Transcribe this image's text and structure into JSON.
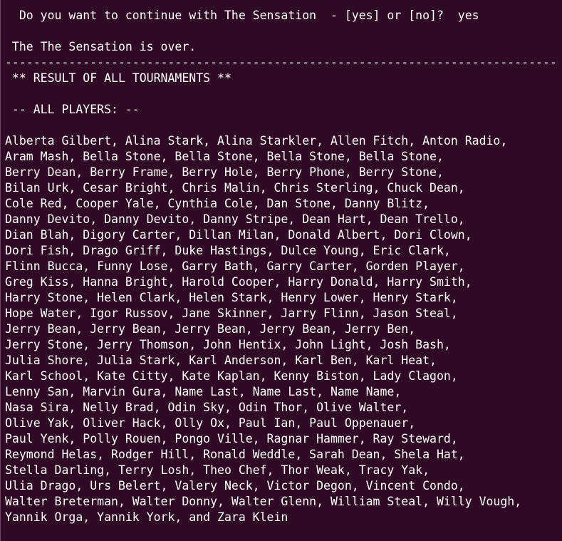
{
  "terminal": {
    "header_lines": [
      "  Do you want to continue with The Sensation  - [yes] or [no]?  yes",
      "",
      " The The Sensation is over.",
      "------------------------------------------------------------------------------",
      " ** RESULT OF ALL TOURNAMENTS **",
      "",
      " -- ALL PLAYERS: --",
      ""
    ],
    "player_lines": [
      "Alberta Gilbert, Alina Stark, Alina Starkler, Allen Fitch, Anton Radio,",
      "Aram Mash, Bella Stone, Bella Stone, Bella Stone, Bella Stone,",
      "Berry Dean, Berry Frame, Berry Hole, Berry Phone, Berry Stone,",
      "Bilan Urk, Cesar Bright, Chris Malin, Chris Sterling, Chuck Dean,",
      "Cole Red, Cooper Yale, Cynthia Cole, Dan Stone, Danny Blitz,",
      "Danny Devito, Danny Devito, Danny Stripe, Dean Hart, Dean Trello,",
      "Dian Blah, Digory Carter, Dillan Milan, Donald Albert, Dori Clown,",
      "Dori Fish, Drago Griff, Duke Hastings, Dulce Young, Eric Clark,",
      "Flinn Bucca, Funny Lose, Garry Bath, Garry Carter, Gorden Player,",
      "Greg Kiss, Hanna Bright, Harold Cooper, Harry Donald, Harry Smith,",
      "Harry Stone, Helen Clark, Helen Stark, Henry Lower, Henry Stark,",
      "Hope Water, Igor Russov, Jane Skinner, Jarry Flinn, Jason Steal,",
      "Jerry Bean, Jerry Bean, Jerry Bean, Jerry Bean, Jerry Ben,",
      "Jerry Stone, Jerry Thomson, John Hentix, John Light, Josh Bash,",
      "Julia Shore, Julia Stark, Karl Anderson, Karl Ben, Karl Heat,",
      "Karl School, Kate Citty, Kate Kaplan, Kenny Biston, Lady Clagon,",
      "Lenny San, Marvin Gura, Name Last, Name Last, Name Name,",
      "Nasa Sira, Nelly Brad, Odin Sky, Odin Thor, Olive Walter,",
      "Olive Yak, Oliver Hack, Olly Ox, Paul Ian, Paul Oppenauer,",
      "Paul Yenk, Polly Rouen, Pongo Ville, Ragnar Hammer, Ray Steward,",
      "Reymond Helas, Rodger Hill, Ronald Weddle, Sarah Dean, Shela Hat,",
      "Stella Darling, Terry Losh, Theo Chef, Thor Weak, Tracy Yak,",
      "Ulia Drago, Urs Belert, Valery Neck, Victor Degon, Vincent Condo,",
      "Walter Breterman, Walter Donny, Walter Glenn, William Steal, Willy Vough,",
      "Yannik Orga, Yannik York, and Zara Klein"
    ]
  },
  "colors": {
    "background": "#300a24",
    "text": "#ffffff"
  }
}
